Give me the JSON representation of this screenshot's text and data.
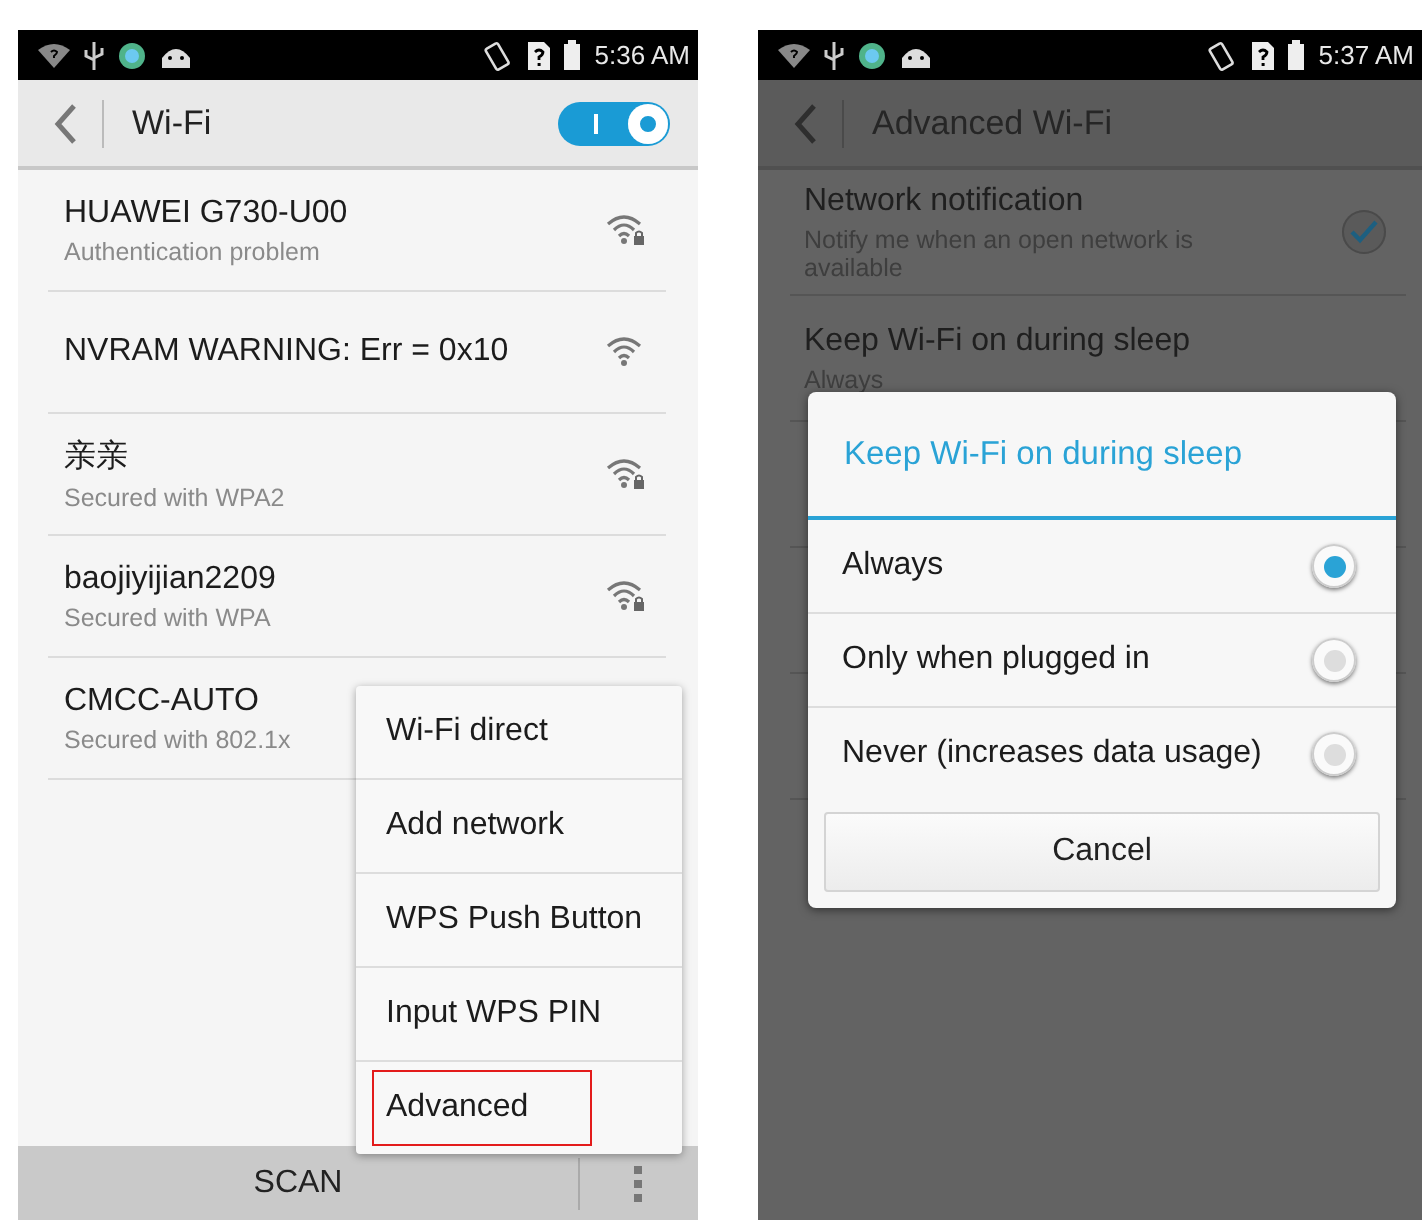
{
  "left_screen": {
    "status_bar": {
      "time": "5:36 AM"
    },
    "header": {
      "title": "Wi-Fi",
      "switch_on": true
    },
    "networks": [
      {
        "name": "HUAWEI G730-U00",
        "status": "Authentication problem",
        "locked": true
      },
      {
        "name": "NVRAM WARNING: Err = 0x10",
        "locked": false
      },
      {
        "name": "亲亲",
        "status": "Secured with WPA2",
        "locked": true
      },
      {
        "name": "baojiyijian2209",
        "status": "Secured with WPA",
        "locked": true
      },
      {
        "name": "CMCC-AUTO",
        "status": "Secured with 802.1x"
      }
    ],
    "menu": [
      {
        "label": "Wi-Fi direct",
        "selected": false
      },
      {
        "label": "Add network",
        "selected": false
      },
      {
        "label": "WPS Push Button",
        "selected": false
      },
      {
        "label": "Input WPS PIN",
        "selected": false
      },
      {
        "label": "Advanced",
        "selected": true
      }
    ],
    "bottom_bar": {
      "button": "SCAN"
    }
  },
  "right_screen": {
    "status_bar": {
      "time": "5:37 AM"
    },
    "header": {
      "title": "Advanced Wi-Fi"
    },
    "settings": [
      {
        "title": "Network notification",
        "summary": "Notify me when an open network is available",
        "kind": "checkbox",
        "checked": true
      },
      {
        "title": "Keep Wi-Fi on during sleep",
        "summary": "Always",
        "kind": "plain"
      }
    ],
    "dialog": {
      "title": "Keep Wi-Fi on during sleep",
      "options": [
        {
          "label": "Always",
          "selected": true
        },
        {
          "label": "Only when plugged in",
          "selected": false
        },
        {
          "label": "Never (increases data usage)",
          "selected": false
        }
      ],
      "button": "Cancel"
    }
  }
}
